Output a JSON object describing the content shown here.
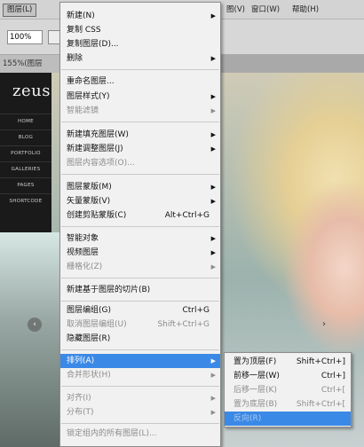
{
  "menubar": {
    "layer": "图层(L)",
    "view": "图(V)",
    "window": "窗口(W)",
    "help": "帮助(H)"
  },
  "options_bar": {
    "zoom": "100%"
  },
  "document_tab": {
    "title": "155%(图层"
  },
  "website": {
    "logo": "zeus",
    "nav": [
      "HOME",
      "BLOG",
      "PORTFOLIO",
      "GALLERIES",
      "PAGES",
      "SHORTCODE"
    ]
  },
  "layer_menu": {
    "new": "新建(N)",
    "copy_css": "复制 CSS",
    "duplicate_layer": "复制图层(D)...",
    "delete": "删除",
    "rename_layer": "重命名图层...",
    "layer_style": "图层样式(Y)",
    "smart_filter": "智能滤镜",
    "new_fill_layer": "新建填充图层(W)",
    "new_adjustment_layer": "新建调整图层(J)",
    "layer_content_options": "图层内容选项(O)...",
    "layer_mask": "图层蒙版(M)",
    "vector_mask": "矢量蒙版(V)",
    "create_clipping_mask": "创建剪贴蒙版(C)",
    "create_clipping_mask_shortcut": "Alt+Ctrl+G",
    "smart_objects": "智能对象",
    "video_layers": "视频图层",
    "rasterize": "栅格化(Z)",
    "new_layer_based_slice": "新建基于图层的切片(B)",
    "group_layers": "图层编组(G)",
    "group_layers_shortcut": "Ctrl+G",
    "ungroup_layers": "取消图层编组(U)",
    "ungroup_layers_shortcut": "Shift+Ctrl+G",
    "hide_layers": "隐藏图层(R)",
    "arrange": "排列(A)",
    "combine_shapes": "合并形状(H)",
    "align": "对齐(I)",
    "distribute": "分布(T)",
    "cut_off_partial": "锁定组内的所有图层(L)..."
  },
  "arrange_submenu": {
    "bring_to_front": "置为顶层(F)",
    "bring_to_front_shortcut": "Shift+Ctrl+]",
    "bring_forward": "前移一层(W)",
    "bring_forward_shortcut": "Ctrl+]",
    "send_backward": "后移一层(K)",
    "send_backward_shortcut": "Ctrl+[",
    "send_to_back": "置为底层(B)",
    "send_to_back_shortcut": "Shift+Ctrl+[",
    "reverse": "反向(R)"
  },
  "icons": {
    "submenu_arrow": "triangle-right-icon"
  },
  "colors": {
    "highlight": "#3b89e6",
    "menu_bg": "#f1f1f1",
    "disabled_text": "#8c8c8c"
  }
}
